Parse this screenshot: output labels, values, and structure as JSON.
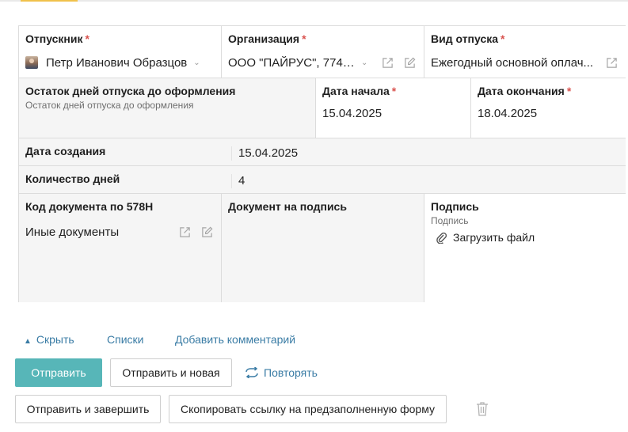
{
  "form": {
    "employee": {
      "label": "Отпускник",
      "required": "*",
      "value": "Петр Иванович Образцов"
    },
    "organization": {
      "label": "Организация",
      "required": "*",
      "value": "ООО \"ПАЙРУС\", 7743..."
    },
    "leave_type": {
      "label": "Вид отпуска",
      "required": "*",
      "value": "Ежегодный основной оплач..."
    },
    "remaining_days": {
      "label": "Остаток дней отпуска до оформления",
      "hint": "Остаток дней отпуска до оформления"
    },
    "start_date": {
      "label": "Дата начала",
      "required": "*",
      "value": "15.04.2025"
    },
    "end_date": {
      "label": "Дата окончания",
      "required": "*",
      "value": "18.04.2025"
    },
    "created_date": {
      "label": "Дата создания",
      "value": "15.04.2025"
    },
    "days_count": {
      "label": "Количество дней",
      "value": "4"
    },
    "doc_code": {
      "label": "Код документа по 578Н",
      "value": "Иные документы"
    },
    "doc_to_sign": {
      "label": "Документ на подпись"
    },
    "signature": {
      "label": "Подпись",
      "hint": "Подпись",
      "upload_label": "Загрузить файл"
    }
  },
  "links": {
    "hide": "Скрыть",
    "hide_icon": "▲",
    "lists": "Списки",
    "add_comment": "Добавить комментарий"
  },
  "actions": {
    "send": "Отправить",
    "send_and_new": "Отправить и новая",
    "repeat": "Повторять",
    "send_and_finish": "Отправить и завершить",
    "copy_link": "Скопировать ссылку на предзаполненную форму"
  },
  "colors": {
    "primary_button": "#57b6b8",
    "link": "#3a7ca5",
    "required": "#d9534f",
    "tab_accent": "#f0c14b"
  },
  "icons": {
    "external_link": "external-link-icon",
    "edit": "edit-icon",
    "paperclip": "paperclip-icon",
    "repeat": "repeat-icon",
    "trash": "trash-icon",
    "chevron": "chevron-down-icon"
  }
}
